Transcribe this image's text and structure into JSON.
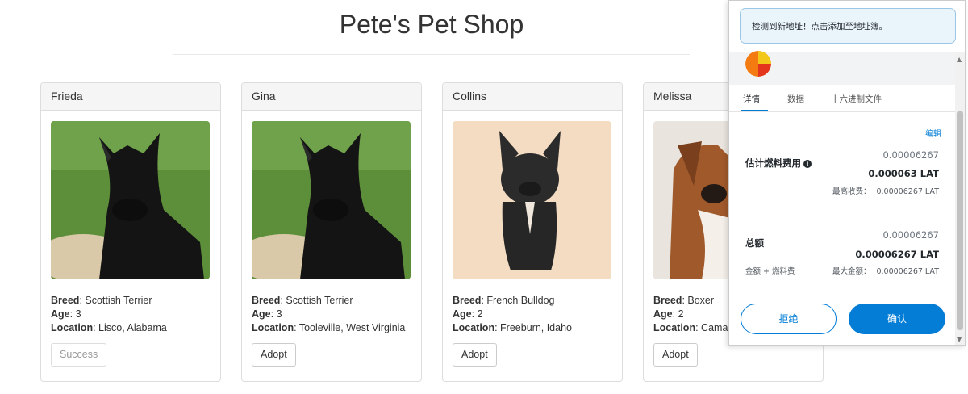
{
  "shop": {
    "title": "Pete's Pet Shop"
  },
  "pets": [
    {
      "name": "Frieda",
      "breed_label": "Breed",
      "breed": "Scottish Terrier",
      "age_label": "Age",
      "age": "3",
      "location_label": "Location",
      "location": "Lisco, Alabama",
      "button": "Success",
      "photo": "scottish-terrier"
    },
    {
      "name": "Gina",
      "breed_label": "Breed",
      "breed": "Scottish Terrier",
      "age_label": "Age",
      "age": "3",
      "location_label": "Location",
      "location": "Tooleville, West Virginia",
      "button": "Adopt",
      "photo": "scottish-terrier"
    },
    {
      "name": "Collins",
      "breed_label": "Breed",
      "breed": "French Bulldog",
      "age_label": "Age",
      "age": "2",
      "location_label": "Location",
      "location": "Freeburn, Idaho",
      "button": "Adopt",
      "photo": "french-bulldog"
    },
    {
      "name": "Melissa",
      "breed_label": "Breed",
      "breed": "Boxer",
      "age_label": "Age",
      "age": "2",
      "location_label": "Location",
      "location": "Camas",
      "button": "Adopt",
      "photo": "boxer"
    }
  ],
  "wallet": {
    "notice": "检测到新地址！点击添加至地址簿。",
    "tabs": [
      "详情",
      "数据",
      "十六进制文件"
    ],
    "edit": "编辑",
    "gas": {
      "label": "估计燃料费用",
      "value": "0.00006267",
      "value_bold": "0.000063 LAT",
      "max_label": "最高收费：",
      "max_value": "0.00006267 LAT"
    },
    "total": {
      "label": "总额",
      "sub_label": "金额 + 燃料费",
      "value": "0.00006267",
      "value_bold": "0.00006267 LAT",
      "max_label": "最大金额：",
      "max_value": "0.00006267 LAT"
    },
    "reject": "拒绝",
    "confirm": "确认",
    "colors": {
      "accent": "#037dd6",
      "notice_bg": "#eaf4fb"
    }
  }
}
